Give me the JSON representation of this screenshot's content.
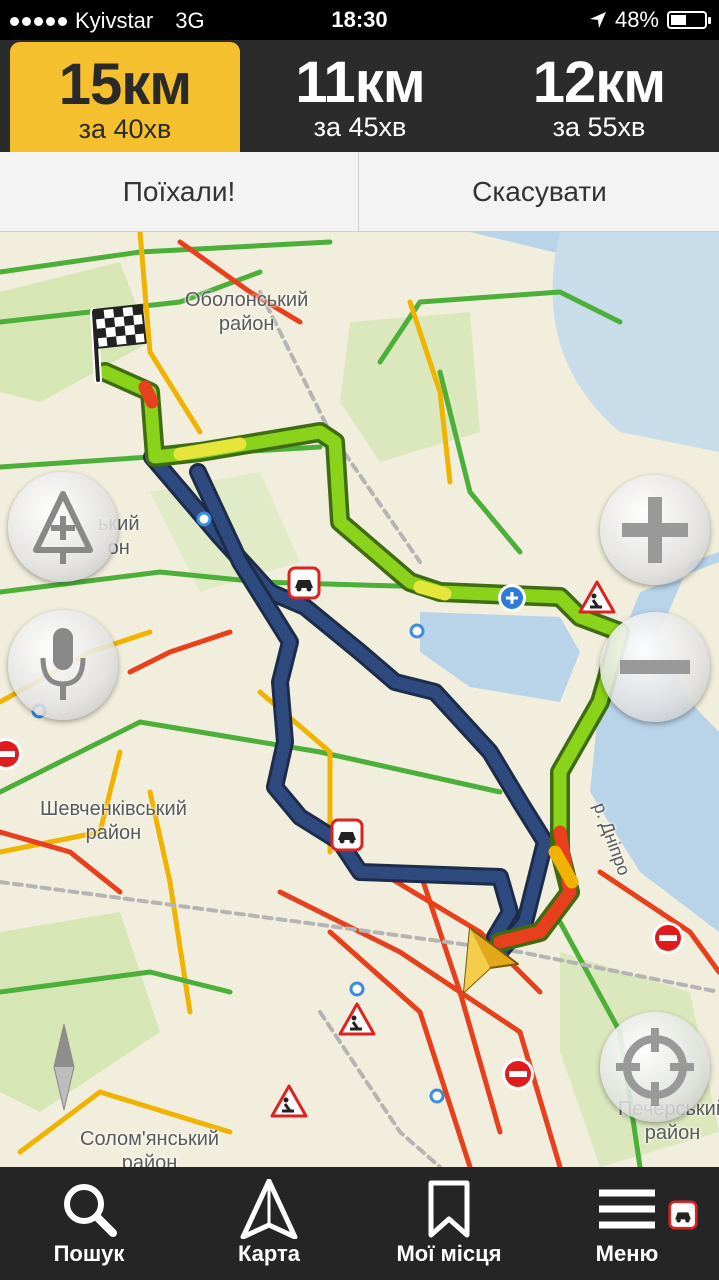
{
  "status": {
    "carrier": "Kyivstar",
    "network": "3G",
    "time": "18:30",
    "battery": "48%",
    "battery_level": 0.48
  },
  "routes": [
    {
      "distance": "15км",
      "duration": "за 40хв",
      "selected": true
    },
    {
      "distance": "11км",
      "duration": "за 45хв",
      "selected": false
    },
    {
      "distance": "12км",
      "duration": "за 55хв",
      "selected": false
    }
  ],
  "actions": {
    "go_label": "Поїхали!",
    "cancel_label": "Скасувати"
  },
  "map": {
    "districts": {
      "obolonskyi": "Оболонський\nрайон",
      "podilskyi": "П...ський",
      "shevchenkivskyi": "Шевченківський\nрайон",
      "solomianskyi": "Солом'янський\nрайон",
      "pecherskyi": "Печерський\nрайон",
      "dnipro": "р. Дніпро"
    },
    "colors": {
      "selected_route": "#8ad31a",
      "alt_route": "#2f4a7e",
      "traffic_green": "#4caf3a",
      "traffic_yellow": "#f0b400",
      "traffic_red": "#e8401c",
      "water": "#b9d3e8",
      "accent": "#f5c02e"
    },
    "icons": [
      "finish-flag-icon",
      "add-road-event-icon",
      "voice-input-icon",
      "zoom-in-icon",
      "zoom-out-icon",
      "compass-icon",
      "locate-me-icon",
      "user-location-arrow-icon",
      "accident-icon",
      "road-works-icon",
      "no-entry-icon",
      "via-point-icon"
    ]
  },
  "toolbar": {
    "search": "Пошук",
    "map": "Карта",
    "places": "Мої місця",
    "menu": "Меню"
  }
}
